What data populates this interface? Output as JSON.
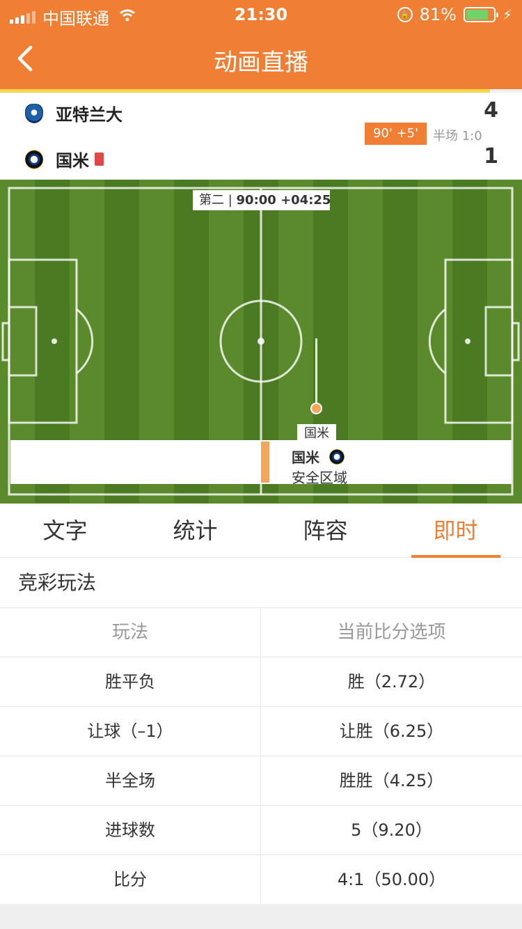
{
  "status_bar": {
    "carrier": "中国联通",
    "time": "21:30",
    "battery": "81%",
    "battery_level": 0.81
  },
  "nav": {
    "title": "动画直播",
    "back_icon": "chevron-left-icon"
  },
  "match": {
    "home": {
      "name": "亚特兰大",
      "goals": "4",
      "logo": "atalanta-crest-icon"
    },
    "away": {
      "name": "国米",
      "goals": "1",
      "logo": "inter-crest-icon",
      "red_cards": 1
    },
    "minute": "90' +5'",
    "halftime": "半场 1:0"
  },
  "pitch": {
    "period_label": "第二",
    "period_time": "90:00 +04:25",
    "ball_team_tag": "国米",
    "info_team": "国米",
    "info_zone": "安全区域",
    "colors": {
      "grass_light": "#5a8a2c",
      "grass_dark": "#4a7a22",
      "marker": "#f3a55e"
    }
  },
  "tabs": [
    {
      "label": "文字",
      "active": false
    },
    {
      "label": "统计",
      "active": false
    },
    {
      "label": "阵容",
      "active": false
    },
    {
      "label": "即时",
      "active": true
    }
  ],
  "section": {
    "title": "竞彩玩法",
    "headers": [
      "玩法",
      "当前比分选项"
    ],
    "rows": [
      [
        "胜平负",
        "胜（2.72）"
      ],
      [
        "让球（–1）",
        "让胜（6.25）"
      ],
      [
        "半全场",
        "胜胜（4.25）"
      ],
      [
        "进球数",
        "5（9.20）"
      ],
      [
        "比分",
        "4:1（50.00）"
      ]
    ]
  },
  "theme": {
    "accent": "#f07f34",
    "highlight": "#f5d74d"
  }
}
